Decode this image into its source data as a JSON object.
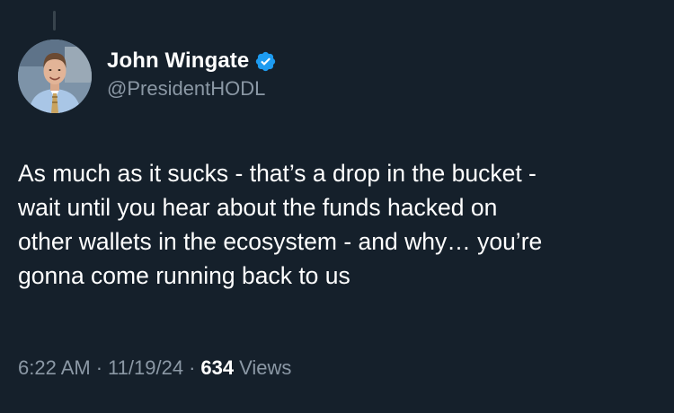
{
  "author": {
    "display_name": "John Wingate",
    "handle": "@PresidentHODL",
    "verified_icon": "verified-badge-icon",
    "verified_color": "#1d9bf0"
  },
  "tweet": {
    "lines": [
      "As much as it sucks - that’s a drop in the bucket -",
      "wait until you hear about the funds hacked on",
      "other wallets in the ecosystem - and why… you’re",
      "gonna come running back to us"
    ]
  },
  "meta": {
    "time": "6:22 AM",
    "separator": "·",
    "date": "11/19/24",
    "views_count": "634",
    "views_label": "Views"
  },
  "colors": {
    "background": "#15202b",
    "primary_text": "#ffffff",
    "secondary_text": "#8b98a5"
  }
}
